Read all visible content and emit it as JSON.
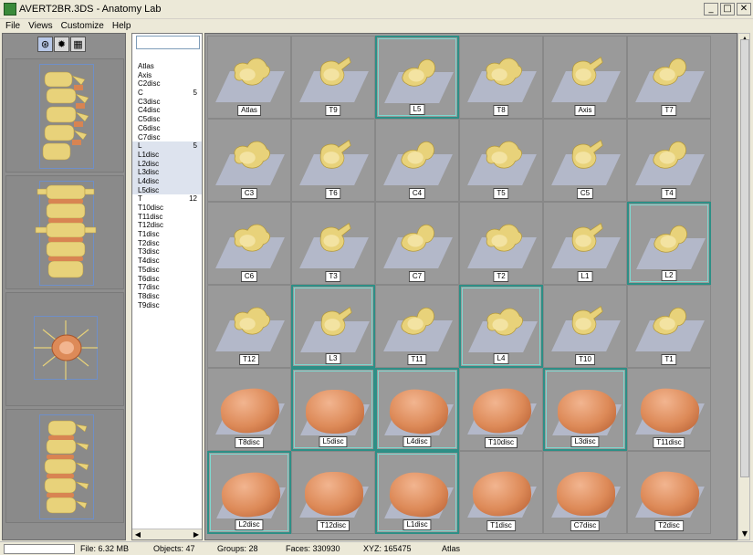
{
  "window": {
    "title": "AVERT2BR.3DS  - Anatomy Lab",
    "min_glyph": "_",
    "max_glyph": "□",
    "close_glyph": "✕"
  },
  "menu": [
    "File",
    "Views",
    "Customize",
    "Help"
  ],
  "view_toolbar": [
    "wireframe-icon",
    "render-icon",
    "color-icon"
  ],
  "parts_list": {
    "search_value": "",
    "items": [
      {
        "label": "Atlas",
        "count": ""
      },
      {
        "label": "Axis",
        "count": ""
      },
      {
        "label": "C2disc",
        "count": ""
      },
      {
        "label": "C",
        "count": "5"
      },
      {
        "label": "C3disc",
        "count": ""
      },
      {
        "label": "C4disc",
        "count": ""
      },
      {
        "label": "C5disc",
        "count": ""
      },
      {
        "label": "C6disc",
        "count": ""
      },
      {
        "label": "C7disc",
        "count": ""
      },
      {
        "label": "L",
        "count": "5"
      },
      {
        "label": "L1disc",
        "count": ""
      },
      {
        "label": "L2disc",
        "count": ""
      },
      {
        "label": "L3disc",
        "count": ""
      },
      {
        "label": "L4disc",
        "count": ""
      },
      {
        "label": "L5disc",
        "count": ""
      },
      {
        "label": "T",
        "count": "12"
      },
      {
        "label": "T10disc",
        "count": ""
      },
      {
        "label": "T11disc",
        "count": ""
      },
      {
        "label": "T12disc",
        "count": ""
      },
      {
        "label": "T1disc",
        "count": ""
      },
      {
        "label": "T2disc",
        "count": ""
      },
      {
        "label": "T3disc",
        "count": ""
      },
      {
        "label": "T4disc",
        "count": ""
      },
      {
        "label": "T5disc",
        "count": ""
      },
      {
        "label": "T6disc",
        "count": ""
      },
      {
        "label": "T7disc",
        "count": ""
      },
      {
        "label": "T8disc",
        "count": ""
      },
      {
        "label": "T9disc",
        "count": ""
      }
    ],
    "scroll_left": "◀",
    "scroll_right": "▶"
  },
  "grid": {
    "cells": [
      {
        "label": "Atlas",
        "kind": "bone",
        "selected": false
      },
      {
        "label": "T9",
        "kind": "bone",
        "selected": false
      },
      {
        "label": "L5",
        "kind": "bone",
        "selected": true
      },
      {
        "label": "T8",
        "kind": "bone",
        "selected": false
      },
      {
        "label": "Axis",
        "kind": "bone",
        "selected": false
      },
      {
        "label": "T7",
        "kind": "bone",
        "selected": false
      },
      {
        "label": "C3",
        "kind": "bone",
        "selected": false
      },
      {
        "label": "T6",
        "kind": "bone",
        "selected": false
      },
      {
        "label": "C4",
        "kind": "bone",
        "selected": false
      },
      {
        "label": "T5",
        "kind": "bone",
        "selected": false
      },
      {
        "label": "C5",
        "kind": "bone",
        "selected": false
      },
      {
        "label": "T4",
        "kind": "bone",
        "selected": false
      },
      {
        "label": "C6",
        "kind": "bone",
        "selected": false
      },
      {
        "label": "T3",
        "kind": "bone",
        "selected": false
      },
      {
        "label": "C7",
        "kind": "bone",
        "selected": false
      },
      {
        "label": "T2",
        "kind": "bone",
        "selected": false
      },
      {
        "label": "L1",
        "kind": "bone",
        "selected": false
      },
      {
        "label": "L2",
        "kind": "bone",
        "selected": true
      },
      {
        "label": "T12",
        "kind": "bone",
        "selected": false
      },
      {
        "label": "L3",
        "kind": "bone",
        "selected": true
      },
      {
        "label": "T11",
        "kind": "bone",
        "selected": false
      },
      {
        "label": "L4",
        "kind": "bone",
        "selected": true
      },
      {
        "label": "T10",
        "kind": "bone",
        "selected": false
      },
      {
        "label": "T1",
        "kind": "bone",
        "selected": false
      },
      {
        "label": "T8disc",
        "kind": "disc",
        "selected": false
      },
      {
        "label": "L5disc",
        "kind": "disc",
        "selected": true
      },
      {
        "label": "L4disc",
        "kind": "disc",
        "selected": true
      },
      {
        "label": "T10disc",
        "kind": "disc",
        "selected": false
      },
      {
        "label": "L3disc",
        "kind": "disc",
        "selected": true
      },
      {
        "label": "T11disc",
        "kind": "disc",
        "selected": false
      },
      {
        "label": "L2disc",
        "kind": "disc",
        "selected": true
      },
      {
        "label": "T12disc",
        "kind": "disc",
        "selected": false
      },
      {
        "label": "L1disc",
        "kind": "disc",
        "selected": true
      },
      {
        "label": "T1disc",
        "kind": "disc",
        "selected": false
      },
      {
        "label": "C7disc",
        "kind": "disc",
        "selected": false
      },
      {
        "label": "T2disc",
        "kind": "disc",
        "selected": false
      }
    ]
  },
  "scrollbar": {
    "up": "▲",
    "down": "▼"
  },
  "status": {
    "file": "File: 6.32 MB",
    "objects": "Objects: 47",
    "groups": "Groups: 28",
    "faces": "Faces: 330930",
    "xyz": "XYZ: 165475",
    "current": "Atlas"
  },
  "colors": {
    "bone": "#e8d27a",
    "disc": "#dd8a58",
    "selection": "#2d8f86"
  }
}
